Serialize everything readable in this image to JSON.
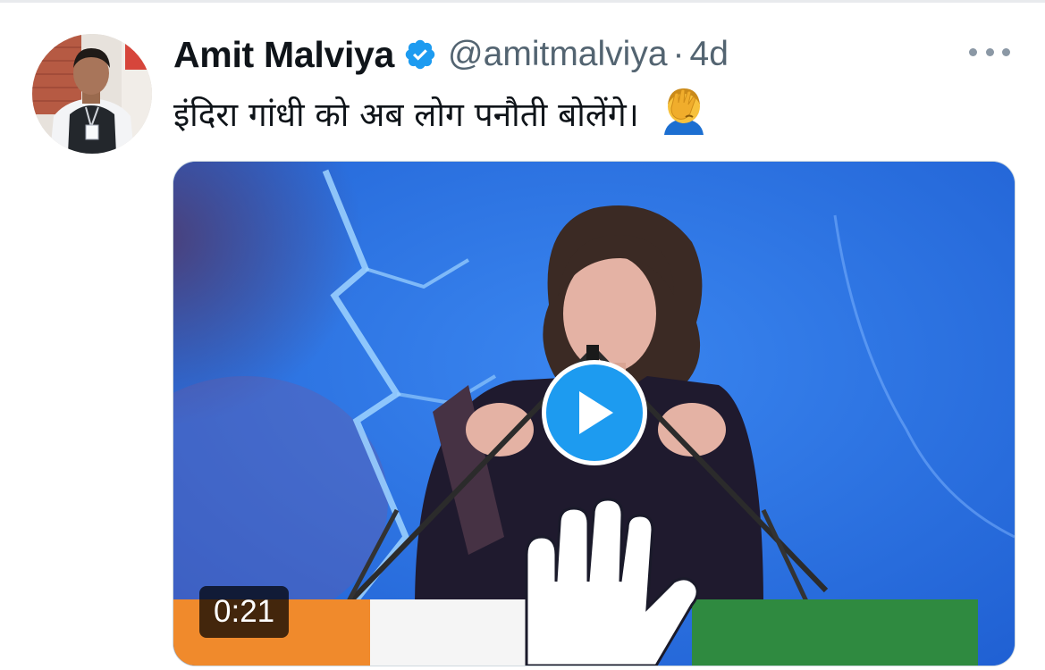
{
  "tweet": {
    "author_name": "Amit Malviya",
    "handle": "@amitmalviya",
    "separator": "·",
    "age": "4d",
    "text": "इंदिरा गांधी को अब लोग पनौती बोलेंगे।",
    "emoji": "face-palm-emoji"
  },
  "media": {
    "type": "video",
    "duration": "0:21"
  },
  "colors": {
    "verified": "#1d9bf0",
    "play_button": "#1d9bf0",
    "text_primary": "#0f1419",
    "text_secondary": "#536471",
    "media_background": "#2f6fe0"
  }
}
